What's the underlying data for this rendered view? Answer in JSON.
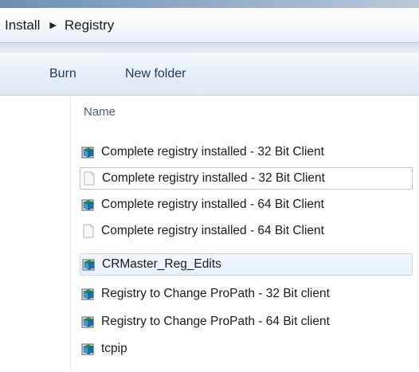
{
  "address": {
    "crumbs": [
      "Install",
      "Registry"
    ],
    "separator": "▶"
  },
  "toolbar": {
    "burn_label": "Burn",
    "new_folder_label": "New folder"
  },
  "list": {
    "column_header": "Name",
    "files": [
      {
        "name": "Complete registry installed - 32 Bit Client",
        "icon": "registry-file-icon"
      },
      {
        "name": "Complete registry installed - 32 Bit Client",
        "icon": "text-file-icon"
      },
      {
        "name": "Complete registry installed - 64 Bit Client",
        "icon": "registry-file-icon"
      },
      {
        "name": "Complete registry installed - 64 Bit Client",
        "icon": "text-file-icon"
      },
      {
        "name": "CRMaster_Reg_Edits",
        "icon": "registry-file-icon"
      },
      {
        "name": "Registry to Change ProPath - 32 Bit client",
        "icon": "registry-file-icon"
      },
      {
        "name": "Registry to Change ProPath - 64 Bit client",
        "icon": "registry-file-icon"
      },
      {
        "name": "tcpip",
        "icon": "registry-file-icon"
      }
    ]
  },
  "colors": {
    "toolbar_text": "#1e395b",
    "header_text": "#4c607a",
    "selection_border": "#b3c8e0"
  }
}
